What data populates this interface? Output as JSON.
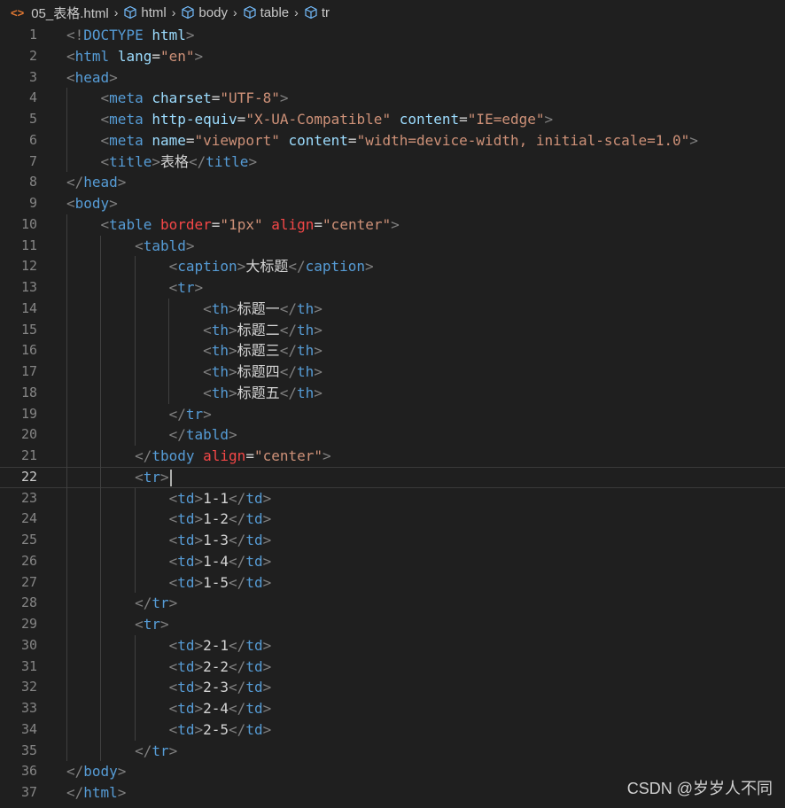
{
  "breadcrumb": {
    "file": "05_表格.html",
    "items": [
      "html",
      "body",
      "table",
      "tr"
    ]
  },
  "editor": {
    "current_line": 22,
    "cursor_after": "<tr>",
    "lines": [
      "<!DOCTYPE html>",
      "<html lang=\"en\">",
      "<head>",
      "    <meta charset=\"UTF-8\">",
      "    <meta http-equiv=\"X-UA-Compatible\" content=\"IE=edge\">",
      "    <meta name=\"viewport\" content=\"width=device-width, initial-scale=1.0\">",
      "    <title>表格</title>",
      "</head>",
      "<body>",
      "    <table border=\"1px\" align=\"center\">",
      "        <tabld>",
      "            <caption>大标题</caption>",
      "            <tr>",
      "                <th>标题一</th>",
      "                <th>标题二</th>",
      "                <th>标题三</th>",
      "                <th>标题四</th>",
      "                <th>标题五</th>",
      "            </tr>",
      "            </tabld>",
      "        </tbody align=\"center\">",
      "        <tr>",
      "            <td>1-1</td>",
      "            <td>1-2</td>",
      "            <td>1-3</td>",
      "            <td>1-4</td>",
      "            <td>1-5</td>",
      "        </tr>",
      "        <tr>",
      "            <td>2-1</td>",
      "            <td>2-2</td>",
      "            <td>2-3</td>",
      "            <td>2-4</td>",
      "            <td>2-5</td>",
      "        </tr>",
      "</body>",
      "</html>"
    ]
  },
  "watermark": "CSDN @岁岁人不同",
  "colors": {
    "background": "#1f1f1f",
    "punctuation": "#808080",
    "tag": "#569cd6",
    "attribute": "#9cdcfe",
    "deprecated_attribute": "#f44747",
    "string": "#ce9178",
    "text": "#d4d4d4",
    "line_number": "#858585"
  }
}
